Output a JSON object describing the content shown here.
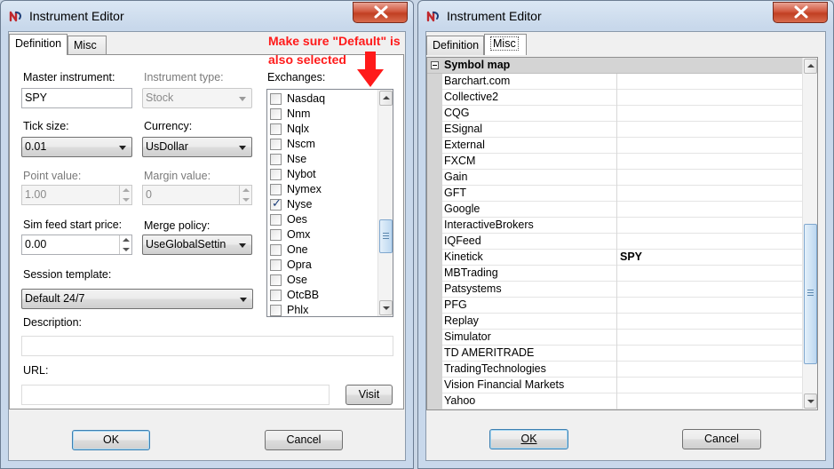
{
  "left_window": {
    "title": "Instrument Editor",
    "tabs": [
      "Definition",
      "Misc"
    ],
    "active_tab": "Definition",
    "annotation": [
      "Make sure \"Default\" is",
      "also selected"
    ],
    "fields": {
      "master_instrument": {
        "label": "Master instrument:",
        "value": "SPY"
      },
      "instrument_type": {
        "label": "Instrument type:",
        "value": "Stock"
      },
      "tick_size": {
        "label": "Tick size:",
        "value": "0.01"
      },
      "currency": {
        "label": "Currency:",
        "value": "UsDollar"
      },
      "point_value": {
        "label": "Point value:",
        "value": "1.00"
      },
      "margin_value": {
        "label": "Margin value:",
        "value": "0"
      },
      "sim_feed_start_price": {
        "label": "Sim feed start price:",
        "value": "0.00"
      },
      "merge_policy": {
        "label": "Merge policy:",
        "value": "UseGlobalSettin"
      },
      "session_template": {
        "label": "Session template:",
        "value": "Default 24/7"
      },
      "description": {
        "label": "Description:",
        "value": ""
      },
      "url": {
        "label": "URL:",
        "value": ""
      }
    },
    "exchanges_label": "Exchanges:",
    "exchanges": [
      {
        "name": "Nasdaq",
        "checked": false
      },
      {
        "name": "Nnm",
        "checked": false
      },
      {
        "name": "Nqlx",
        "checked": false
      },
      {
        "name": "Nscm",
        "checked": false
      },
      {
        "name": "Nse",
        "checked": false
      },
      {
        "name": "Nybot",
        "checked": false
      },
      {
        "name": "Nymex",
        "checked": false
      },
      {
        "name": "Nyse",
        "checked": true
      },
      {
        "name": "Oes",
        "checked": false
      },
      {
        "name": "Omx",
        "checked": false
      },
      {
        "name": "One",
        "checked": false
      },
      {
        "name": "Opra",
        "checked": false
      },
      {
        "name": "Ose",
        "checked": false
      },
      {
        "name": "OtcBB",
        "checked": false
      },
      {
        "name": "Phlx",
        "checked": false
      }
    ],
    "visit_label": "Visit",
    "ok_label": "OK",
    "cancel_label": "Cancel"
  },
  "right_window": {
    "title": "Instrument Editor",
    "tabs": [
      "Definition",
      "Misc"
    ],
    "active_tab": "Misc",
    "category": "Symbol map",
    "rows": [
      {
        "name": "Barchart.com",
        "value": ""
      },
      {
        "name": "Collective2",
        "value": ""
      },
      {
        "name": "CQG",
        "value": ""
      },
      {
        "name": "ESignal",
        "value": ""
      },
      {
        "name": "External",
        "value": ""
      },
      {
        "name": "FXCM",
        "value": ""
      },
      {
        "name": "Gain",
        "value": ""
      },
      {
        "name": "GFT",
        "value": ""
      },
      {
        "name": "Google",
        "value": ""
      },
      {
        "name": "InteractiveBrokers",
        "value": ""
      },
      {
        "name": "IQFeed",
        "value": ""
      },
      {
        "name": "Kinetick",
        "value": "SPY"
      },
      {
        "name": "MBTrading",
        "value": ""
      },
      {
        "name": "Patsystems",
        "value": ""
      },
      {
        "name": "PFG",
        "value": ""
      },
      {
        "name": "Replay",
        "value": ""
      },
      {
        "name": "Simulator",
        "value": ""
      },
      {
        "name": "TD AMERITRADE",
        "value": ""
      },
      {
        "name": "TradingTechnologies",
        "value": ""
      },
      {
        "name": "Vision Financial Markets",
        "value": ""
      },
      {
        "name": "Yahoo",
        "value": ""
      }
    ],
    "ok_label": "OK",
    "cancel_label": "Cancel"
  },
  "colors": {
    "annotation": "#ff1a1a",
    "close_button": "#c94a2e"
  }
}
